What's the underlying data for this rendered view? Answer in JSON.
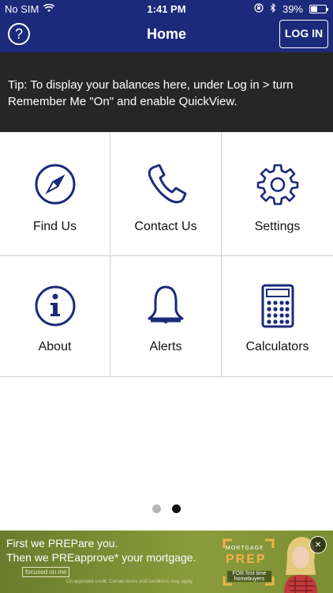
{
  "status_bar": {
    "carrier": "No SIM",
    "time": "1:41 PM",
    "battery_text": "39%",
    "battery_level": 0.39,
    "icons": [
      "wifi-icon",
      "orientation-lock-icon",
      "bluetooth-icon",
      "battery-icon"
    ]
  },
  "nav": {
    "help_label": "?",
    "title": "Home",
    "login_label": "LOG IN"
  },
  "tip": {
    "text": "Tip: To display your balances here, under Log in > turn Remember Me \"On\" and enable QuickView."
  },
  "tiles": [
    {
      "label": "Find Us",
      "icon": "compass-icon"
    },
    {
      "label": "Contact Us",
      "icon": "phone-icon"
    },
    {
      "label": "Settings",
      "icon": "gear-icon"
    },
    {
      "label": "About",
      "icon": "info-icon"
    },
    {
      "label": "Alerts",
      "icon": "bell-icon"
    },
    {
      "label": "Calculators",
      "icon": "calculator-icon"
    }
  ],
  "pager": {
    "pages": 2,
    "current": 2
  },
  "ad": {
    "line1": "First we PREPare you.",
    "line2": "Then we PREapprove* your mortgage.",
    "brand": "focused on me",
    "fine_print": "On approved credit. Certain terms and conditions may apply.",
    "mortgage_label": "MORTGAGE",
    "prep_label": "PREP",
    "tagline": "FOR first time homebuyers",
    "close_label": "×"
  },
  "colors": {
    "nav_bg": "#1b2a7a",
    "tip_bg": "#262626",
    "icon_color": "#1b2a7a",
    "ad_bg": "#7c8e33"
  }
}
